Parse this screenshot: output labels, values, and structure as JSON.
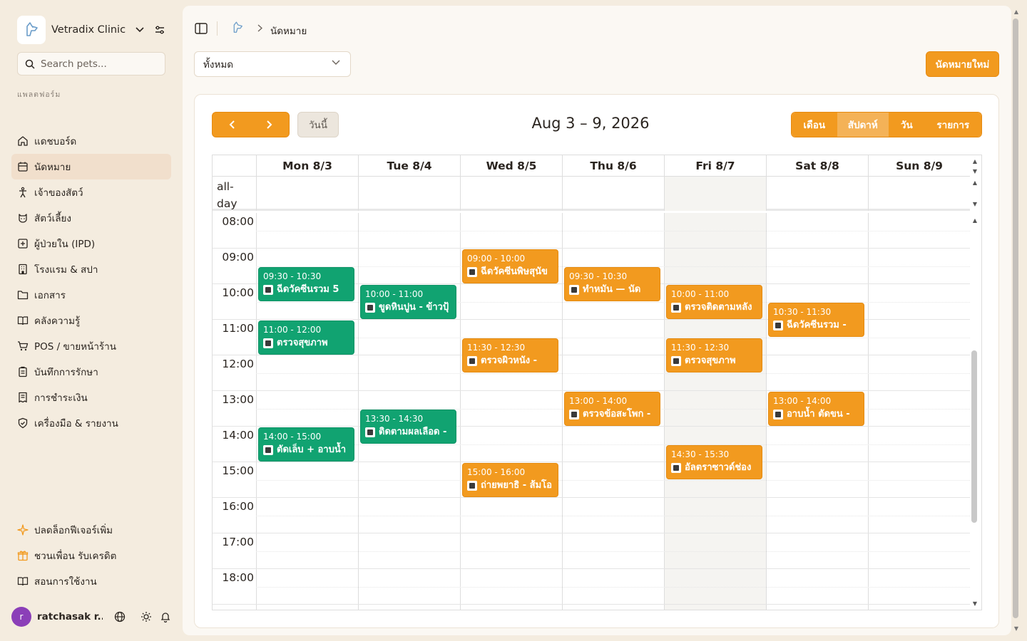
{
  "sidebar": {
    "clinic_name": "Vetradix Clinic",
    "search_placeholder": "Search pets...",
    "section_label": "แพลตฟอร์ม",
    "items": [
      {
        "label": "แดชบอร์ด",
        "icon": "home-icon"
      },
      {
        "label": "นัดหมาย",
        "icon": "calendar-icon",
        "active": true
      },
      {
        "label": "เจ้าของสัตว์",
        "icon": "person-icon"
      },
      {
        "label": "สัตว์เลี้ยง",
        "icon": "pet-icon"
      },
      {
        "label": "ผู้ป่วยใน (IPD)",
        "icon": "hospital-icon"
      },
      {
        "label": "โรงแรม & สปา",
        "icon": "building-icon"
      },
      {
        "label": "เอกสาร",
        "icon": "folder-icon"
      },
      {
        "label": "คลังความรู้",
        "icon": "book-icon"
      },
      {
        "label": "POS / ขายหน้าร้าน",
        "icon": "cart-icon"
      },
      {
        "label": "บันทึกการรักษา",
        "icon": "clipboard-icon"
      },
      {
        "label": "การชำระเงิน",
        "icon": "receipt-icon"
      },
      {
        "label": "เครื่องมือ & รายงาน",
        "icon": "shield-icon"
      }
    ],
    "bottom_items": [
      {
        "label": "ปลดล็อกฟีเจอร์เพิ่ม",
        "icon": "sparkle-icon"
      },
      {
        "label": "ชวนเพื่อน รับเครดิต",
        "icon": "gift-icon"
      },
      {
        "label": "สอนการใช้งาน",
        "icon": "book-open-icon"
      }
    ],
    "user": {
      "initial": "r",
      "name": "ratchasak r..."
    }
  },
  "header": {
    "breadcrumb_current": "นัดหมาย",
    "filter_value": "ทั้งหมด",
    "new_button": "นัดหมายใหม่"
  },
  "toolbar": {
    "today": "วันนี้",
    "range_title": "Aug 3 – 9, 2026",
    "views": [
      "เดือน",
      "สัปดาห์",
      "วัน",
      "รายการ"
    ],
    "active_view": "สัปดาห์"
  },
  "calendar": {
    "allday_label": "all-day",
    "days": [
      "Mon 8/3",
      "Tue 8/4",
      "Wed 8/5",
      "Thu 8/6",
      "Fri 8/7",
      "Sat 8/8",
      "Sun 8/9"
    ],
    "today_index": 4,
    "hours": [
      "08:00",
      "09:00",
      "10:00",
      "11:00",
      "12:00",
      "13:00",
      "14:00",
      "15:00",
      "16:00",
      "17:00",
      "18:00"
    ],
    "events": [
      {
        "day": 0,
        "start": "09:30",
        "end": "10:30",
        "time": "09:30 - 10:30",
        "title": "ฉีดวัคซีนรวม 5",
        "color": "green"
      },
      {
        "day": 0,
        "start": "11:00",
        "end": "12:00",
        "time": "11:00 - 12:00",
        "title": "ตรวจสุขภาพ",
        "color": "green"
      },
      {
        "day": 0,
        "start": "14:00",
        "end": "15:00",
        "time": "14:00 - 15:00",
        "title": "ตัดเล็บ + อาบน้ำ",
        "color": "green"
      },
      {
        "day": 1,
        "start": "10:00",
        "end": "11:00",
        "time": "10:00 - 11:00",
        "title": "ขูดหินปูน - ข้าวปุ้",
        "color": "green"
      },
      {
        "day": 1,
        "start": "13:30",
        "end": "14:30",
        "time": "13:30 - 14:30",
        "title": "ติดตามผลเลือด -",
        "color": "green"
      },
      {
        "day": 2,
        "start": "09:00",
        "end": "10:00",
        "time": "09:00 - 10:00",
        "title": "ฉีดวัคซีนพิษสุนัข",
        "color": "orange"
      },
      {
        "day": 2,
        "start": "11:30",
        "end": "12:30",
        "time": "11:30 - 12:30",
        "title": "ตรวจผิวหนัง -",
        "color": "orange"
      },
      {
        "day": 2,
        "start": "15:00",
        "end": "16:00",
        "time": "15:00 - 16:00",
        "title": "ถ่ายพยาธิ - ส้มโอ",
        "color": "orange"
      },
      {
        "day": 3,
        "start": "09:30",
        "end": "10:30",
        "time": "09:30 - 10:30",
        "title": "ทำหมัน — นัด",
        "color": "orange"
      },
      {
        "day": 3,
        "start": "13:00",
        "end": "14:00",
        "time": "13:00 - 14:00",
        "title": "ตรวจข้อสะโพก -",
        "color": "orange"
      },
      {
        "day": 4,
        "start": "10:00",
        "end": "11:00",
        "time": "10:00 - 11:00",
        "title": "ตรวจติดตามหลัง",
        "color": "orange"
      },
      {
        "day": 4,
        "start": "11:30",
        "end": "12:30",
        "time": "11:30 - 12:30",
        "title": "ตรวจสุขภาพ",
        "color": "orange"
      },
      {
        "day": 4,
        "start": "14:30",
        "end": "15:30",
        "time": "14:30 - 15:30",
        "title": "อัลตราซาวด์ช่อง",
        "color": "orange"
      },
      {
        "day": 5,
        "start": "10:30",
        "end": "11:30",
        "time": "10:30 - 11:30",
        "title": "ฉีดวัคซีนรวม -",
        "color": "orange"
      },
      {
        "day": 5,
        "start": "13:00",
        "end": "14:00",
        "time": "13:00 - 14:00",
        "title": "อาบน้ำ ตัดขน -",
        "color": "orange"
      }
    ]
  },
  "colors": {
    "accent": "#f29a1f",
    "green": "#11a371",
    "sidebar_bg": "#f4ecdf"
  }
}
